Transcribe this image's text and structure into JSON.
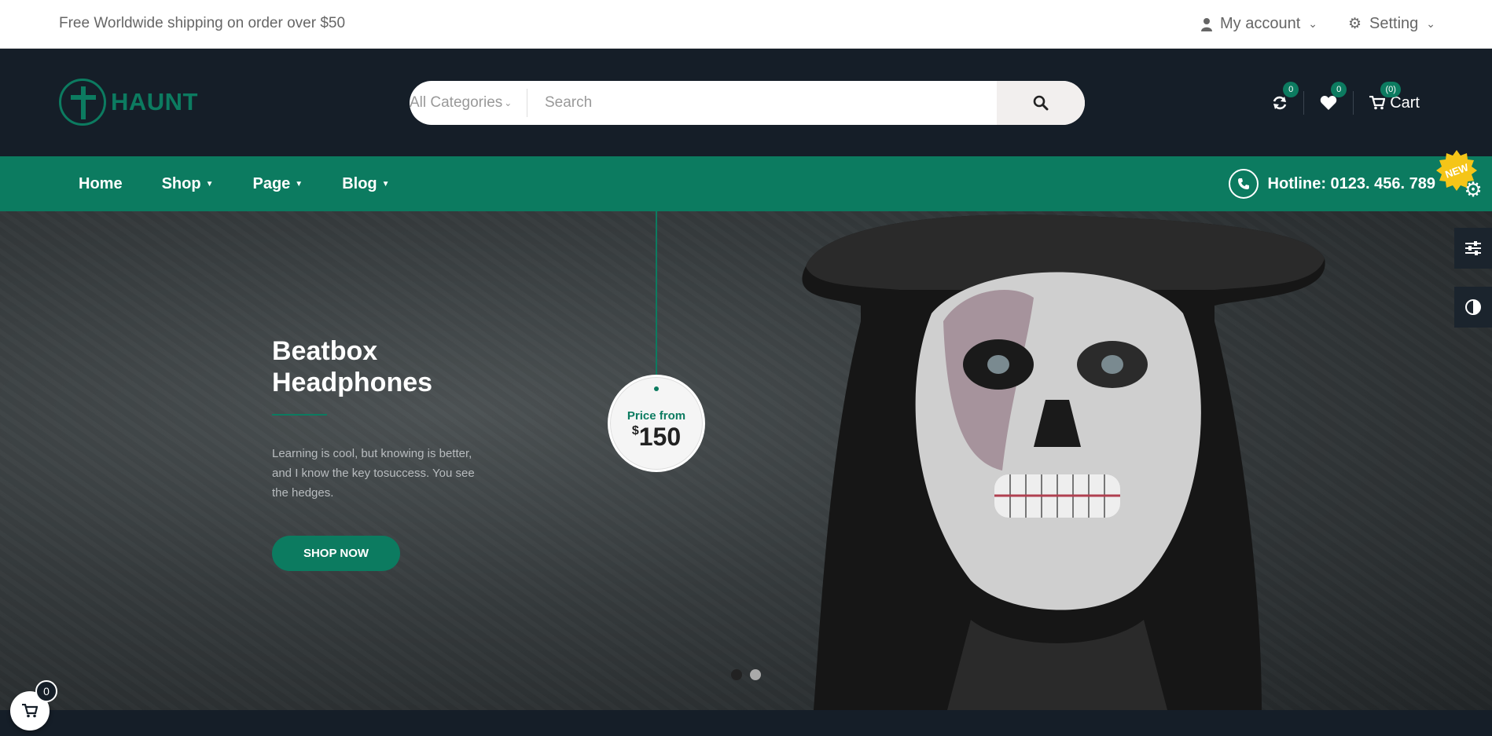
{
  "topbar": {
    "shipping": "Free Worldwide shipping on order over $50",
    "account": "My account",
    "setting": "Setting"
  },
  "brand": {
    "name": "HAUNT",
    "color": "#0c7b60"
  },
  "search": {
    "category": "All Categories",
    "placeholder": "Search"
  },
  "header_icons": {
    "compare_count": "0",
    "wishlist_count": "0",
    "cart_count": "(0)",
    "cart_label": "Cart"
  },
  "nav": {
    "items": [
      "Home",
      "Shop",
      "Page",
      "Blog"
    ],
    "hotline": "Hotline: 0123. 456. 789"
  },
  "hero": {
    "title_line1": "Beatbox",
    "title_line2": "Headphones",
    "text": "Learning is cool, but knowing is better, and I know the key tosuccess. You see the hedges.",
    "cta": "SHOP NOW",
    "price_label": "Price from",
    "price_currency": "$",
    "price_value": "150"
  },
  "side_badge": "NEW",
  "float_cart_count": "0",
  "icons": [
    "user-icon",
    "gear-icon",
    "search-icon",
    "refresh-icon",
    "heart-icon",
    "cart-icon",
    "phone-icon",
    "sliders-icon",
    "contrast-icon"
  ]
}
